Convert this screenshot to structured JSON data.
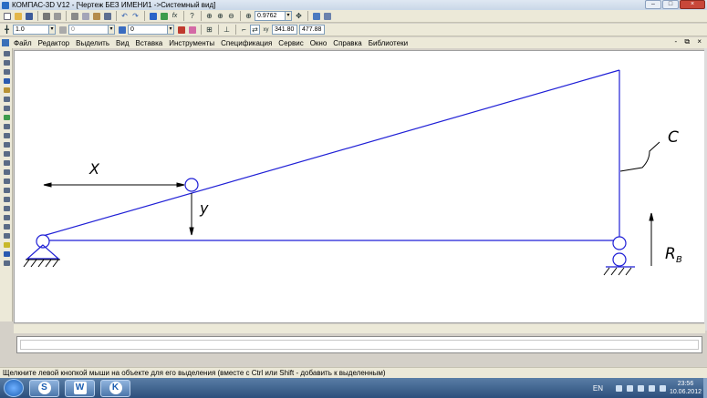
{
  "window": {
    "title": "КОМПАС-3D V12 - [Чертеж БЕЗ ИМЕНИ1 ->Системный вид]"
  },
  "toolbar1": {
    "zoom_value": "0.9762",
    "icons": [
      "new-doc-icon",
      "open-icon",
      "save-icon",
      "print-icon",
      "preview-icon",
      "cut-icon",
      "copy-icon",
      "paste-icon",
      "properties-icon",
      "undo-icon",
      "redo-icon",
      "manager-icon",
      "library-icon",
      "fx-icon",
      "help-icon",
      "zoom-in-icon",
      "zoom-window-icon",
      "zoom-out-icon",
      "pan-icon",
      "refresh-icon",
      "layers-icon"
    ]
  },
  "toolbar2": {
    "line_width": "1.0",
    "layer_field": "0",
    "style_field": "0",
    "coord_x": "341.80",
    "coord_y": "477.88"
  },
  "menu": {
    "items": [
      "Файл",
      "Редактор",
      "Выделить",
      "Вид",
      "Вставка",
      "Инструменты",
      "Спецификация",
      "Сервис",
      "Окно",
      "Справка",
      "Библиотеки"
    ],
    "mdi_controls": "- ⧉ ×"
  },
  "drawing": {
    "label_x": "X",
    "label_y": "y",
    "label_c": "C",
    "label_r": "R",
    "label_r_sub": "B"
  },
  "status": {
    "hint": "Щелкните левой кнопкой мыши на объекте для его выделения (вместе с Ctrl или Shift - добавить к выделенным)"
  },
  "taskbar": {
    "lang": "EN",
    "time": "23:56",
    "date": "10.06.2012"
  },
  "colors": {
    "drawing_blue": "#1f1fd6",
    "drawing_black": "#000000"
  }
}
